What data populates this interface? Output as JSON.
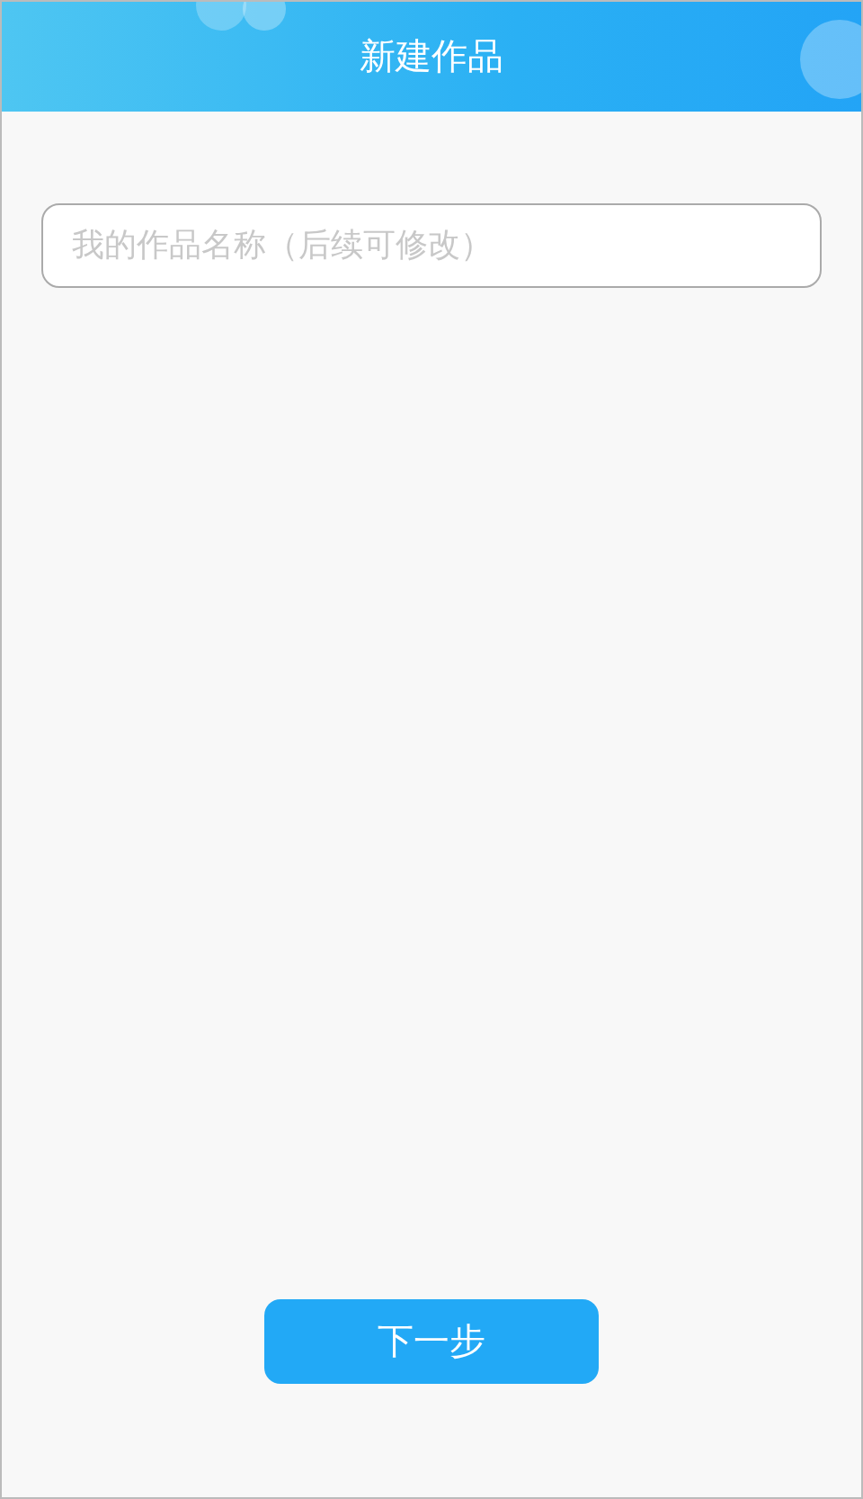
{
  "header": {
    "title": "新建作品"
  },
  "name_field": {
    "placeholder": "我的作品名称（后续可修改）"
  },
  "next_button": {
    "label": "下一步"
  }
}
